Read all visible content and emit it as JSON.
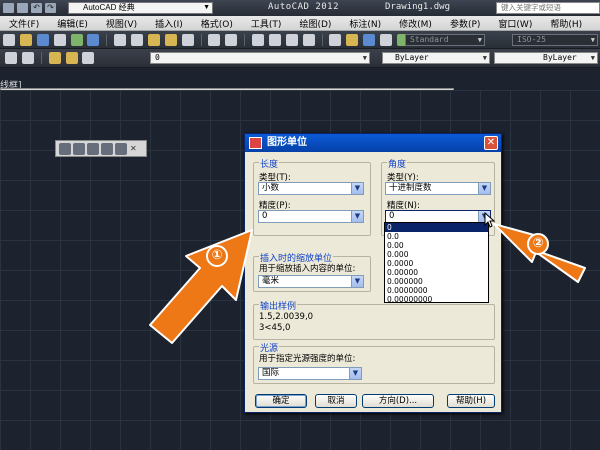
{
  "title_bar": {
    "workspace": "AutoCAD 经典",
    "app_title": "AutoCAD 2012",
    "document": "Drawing1.dwg",
    "search_placeholder": "键入关键字或短语"
  },
  "menu": [
    "文件(F)",
    "编辑(E)",
    "视图(V)",
    "插入(I)",
    "格式(O)",
    "工具(T)",
    "绘图(D)",
    "标注(N)",
    "修改(M)",
    "参数(P)",
    "窗口(W)",
    "帮助(H)"
  ],
  "toolbar1": {
    "text_style": "Standard",
    "dim_style": "ISO-25"
  },
  "toolbar2": {
    "layer_value": "0",
    "color_value": "ByLayer",
    "linetype_value": "ByLayer"
  },
  "toolbar3": {
    "dim_style": "ISO-25"
  },
  "panel_label": "线框]",
  "dialog": {
    "title": "图形单位",
    "length_group": "长度",
    "length_type_label": "类型(T):",
    "length_type_value": "小数",
    "length_precision_label": "精度(P):",
    "length_precision_value": "0",
    "angle_group": "角度",
    "angle_type_label": "类型(Y):",
    "angle_type_value": "十进制度数",
    "angle_precision_label": "精度(N):",
    "angle_precision_value": "0",
    "angle_precision_options": [
      "0",
      "0.0",
      "0.00",
      "0.000",
      "0.0000",
      "0.00000",
      "0.000000",
      "0.0000000",
      "0.00000000"
    ],
    "insert_group": "插入时的缩放单位",
    "insert_label": "用于缩放插入内容的单位:",
    "insert_value": "毫米",
    "sample_group": "输出样例",
    "sample_line1": "1.5,2.0039,0",
    "sample_line2": "3<45,0",
    "light_group": "光源",
    "light_label": "用于指定光源强度的单位:",
    "light_value": "国际",
    "buttons": {
      "ok": "确定",
      "cancel": "取消",
      "direction": "方向(D)...",
      "help": "帮助(H)"
    }
  },
  "annotations": [
    "①",
    "②"
  ],
  "annotation_color": "#ee7716"
}
